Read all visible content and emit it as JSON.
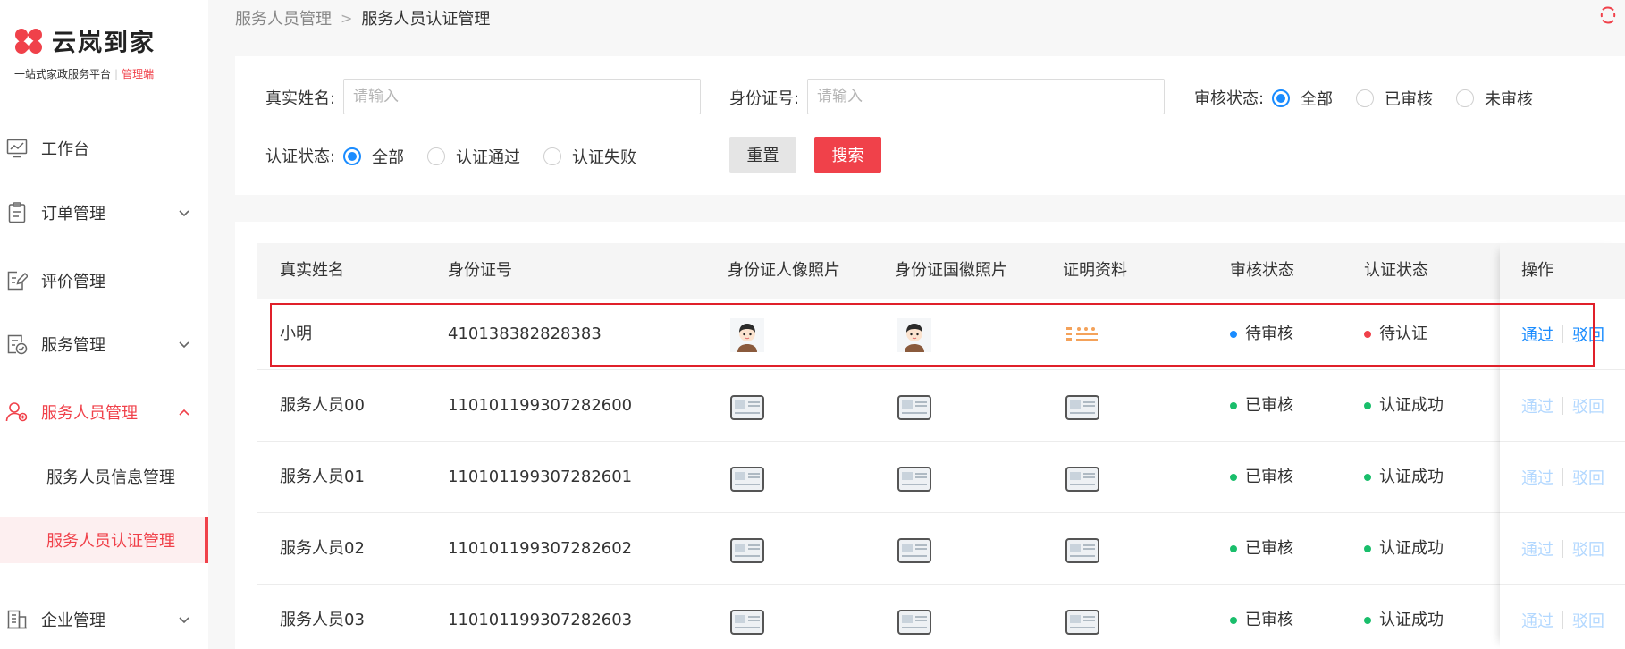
{
  "app": {
    "brand": "云岚到家",
    "slogan": "一站式家政服务平台",
    "role": "管理端"
  },
  "sidebar": {
    "items": [
      {
        "label": "工作台",
        "icon": "dashboard-icon",
        "has_children": false
      },
      {
        "label": "订单管理",
        "icon": "clipboard-icon",
        "has_children": true
      },
      {
        "label": "评价管理",
        "icon": "review-edit-icon",
        "has_children": false
      },
      {
        "label": "服务管理",
        "icon": "service-check-icon",
        "has_children": true
      },
      {
        "label": "服务人员管理",
        "icon": "user-group-icon",
        "has_children": true,
        "expanded": true,
        "active": true
      },
      {
        "label": "企业管理",
        "icon": "building-icon",
        "has_children": true
      }
    ],
    "sub_items": [
      {
        "label": "服务人员信息管理",
        "active": false
      },
      {
        "label": "服务人员认证管理",
        "active": true
      }
    ]
  },
  "breadcrumb": {
    "parent": "服务人员管理",
    "separator": ">",
    "current": "服务人员认证管理"
  },
  "filters": {
    "name_label": "真实姓名:",
    "name_placeholder": "请输入",
    "id_label": "身份证号:",
    "id_placeholder": "请输入",
    "review_label": "审核状态:",
    "review_options": [
      "全部",
      "已审核",
      "未审核"
    ],
    "review_selected": "全部",
    "cert_label": "认证状态:",
    "cert_options": [
      "全部",
      "认证通过",
      "认证失败"
    ],
    "cert_selected": "全部",
    "reset_label": "重置",
    "search_label": "搜索"
  },
  "table": {
    "columns": [
      "真实姓名",
      "身份证号",
      "身份证人像照片",
      "身份证国徽照片",
      "证明资料",
      "审核状态",
      "认证状态",
      "操作"
    ],
    "approve_label": "通过",
    "reject_label": "驳回",
    "rows": [
      {
        "name": "小明",
        "id_number": "410138382828383",
        "review_status": "待审核",
        "review_color": "#1a8cff",
        "cert_status": "待认证",
        "cert_color": "#f0414a",
        "photo_type": "avatar",
        "actions_enabled": true
      },
      {
        "name": "服务人员00",
        "id_number": "110101199307282600",
        "review_status": "已审核",
        "review_color": "#19be6b",
        "cert_status": "认证成功",
        "cert_color": "#19be6b",
        "photo_type": "card",
        "actions_enabled": false
      },
      {
        "name": "服务人员01",
        "id_number": "110101199307282601",
        "review_status": "已审核",
        "review_color": "#19be6b",
        "cert_status": "认证成功",
        "cert_color": "#19be6b",
        "photo_type": "card",
        "actions_enabled": false
      },
      {
        "name": "服务人员02",
        "id_number": "110101199307282602",
        "review_status": "已审核",
        "review_color": "#19be6b",
        "cert_status": "认证成功",
        "cert_color": "#19be6b",
        "photo_type": "card",
        "actions_enabled": false
      },
      {
        "name": "服务人员03",
        "id_number": "110101199307282603",
        "review_status": "已审核",
        "review_color": "#19be6b",
        "cert_status": "认证成功",
        "cert_color": "#19be6b",
        "photo_type": "card",
        "actions_enabled": false
      }
    ]
  },
  "colors": {
    "accent": "#f0414a",
    "link": "#1a8cff",
    "success": "#19be6b"
  }
}
